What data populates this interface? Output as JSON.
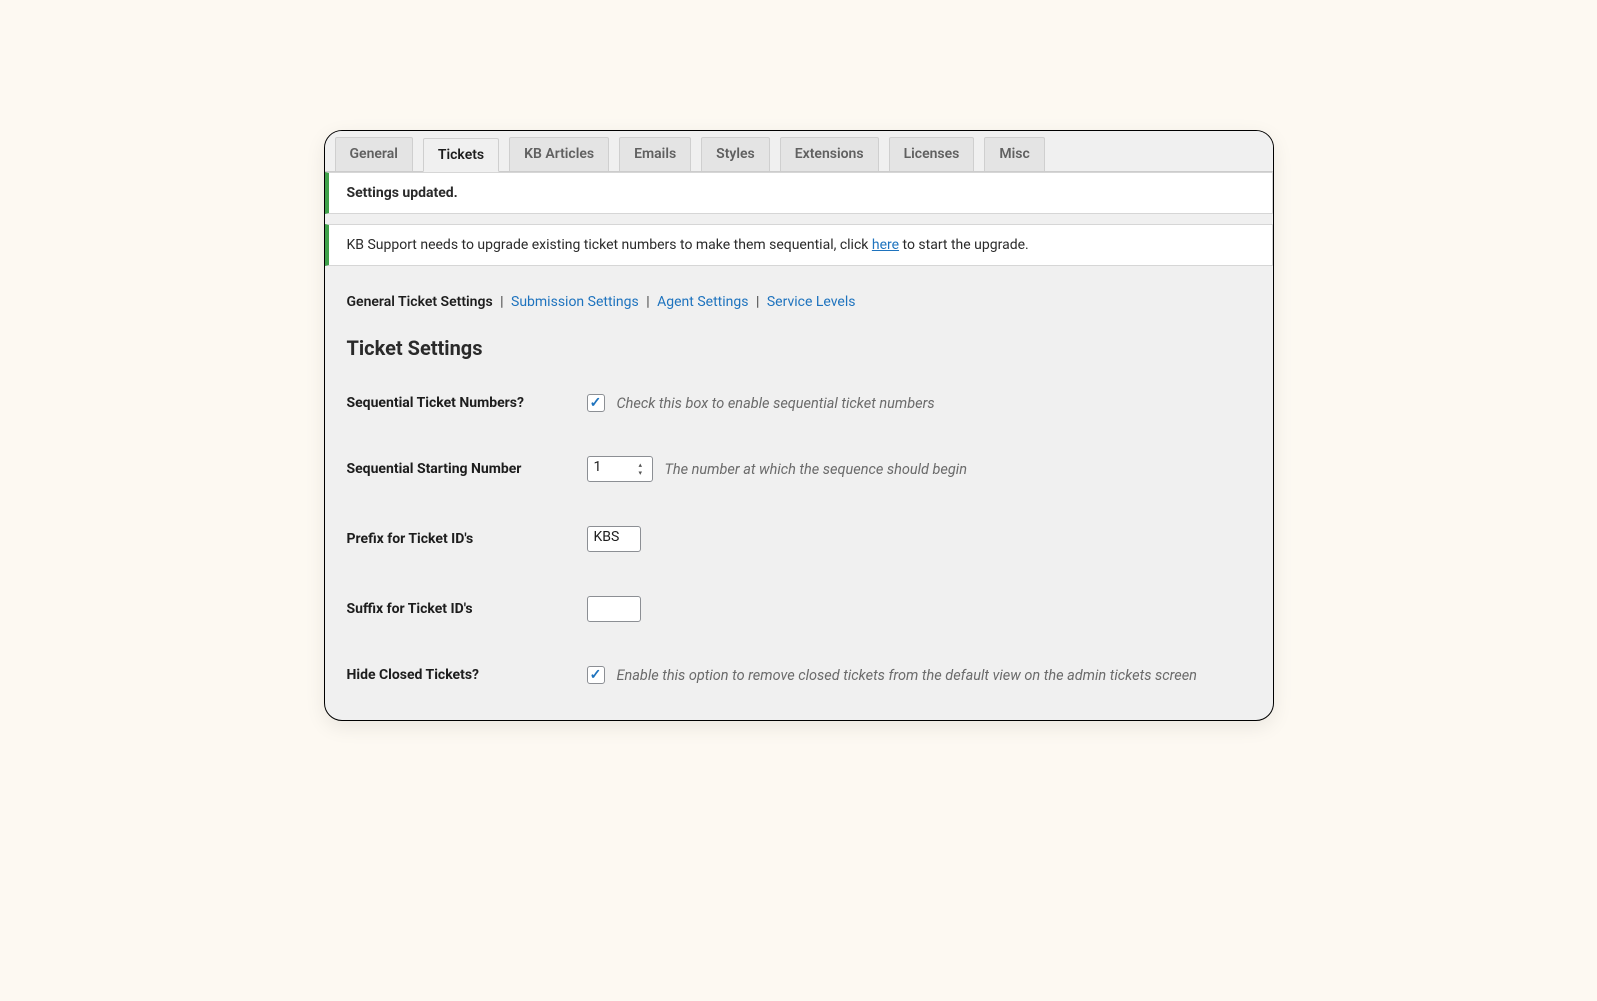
{
  "tabs": {
    "general": "General",
    "tickets": "Tickets",
    "kb_articles": "KB Articles",
    "emails": "Emails",
    "styles": "Styles",
    "extensions": "Extensions",
    "licenses": "Licenses",
    "misc": "Misc"
  },
  "notice1": "Settings updated.",
  "notice2": {
    "pre": "KB Support needs to upgrade existing ticket numbers to make them sequential, click ",
    "link": "here",
    "post": " to start the upgrade."
  },
  "subtabs": {
    "current": "General Ticket Settings",
    "submission": "Submission Settings",
    "agent": "Agent Settings",
    "service": "Service Levels"
  },
  "heading": "Ticket Settings",
  "rows": {
    "seq_enable": {
      "label": "Sequential Ticket Numbers?",
      "desc": "Check this box to enable sequential ticket numbers"
    },
    "seq_start": {
      "label": "Sequential Starting Number",
      "value": "1",
      "desc": "The number at which the sequence should begin"
    },
    "prefix": {
      "label": "Prefix for Ticket ID's",
      "value": "KBS"
    },
    "suffix": {
      "label": "Suffix for Ticket ID's",
      "value": ""
    },
    "hide_closed": {
      "label": "Hide Closed Tickets?",
      "desc": "Enable this option to remove closed tickets from the default view on the admin tickets screen"
    }
  }
}
